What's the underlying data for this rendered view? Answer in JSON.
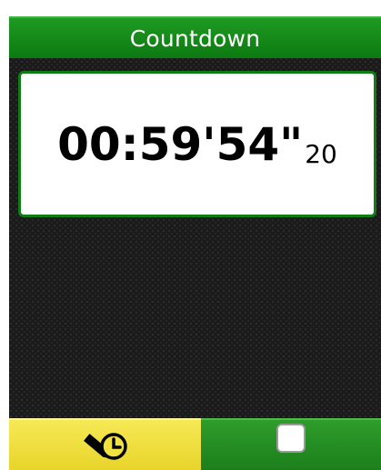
{
  "header": {
    "title": "Countdown"
  },
  "timer": {
    "main": "00:59'54\"",
    "sub": "20"
  },
  "buttons": {
    "left_icon": "pencil-clock-icon",
    "right_icon": "stop-square-icon"
  },
  "colors": {
    "title_bar": "#0c7a10",
    "timer_border": "#0f7d13",
    "left_button": "#f0e040",
    "right_button": "#1c7f1c",
    "background": "#1a1a1a"
  }
}
